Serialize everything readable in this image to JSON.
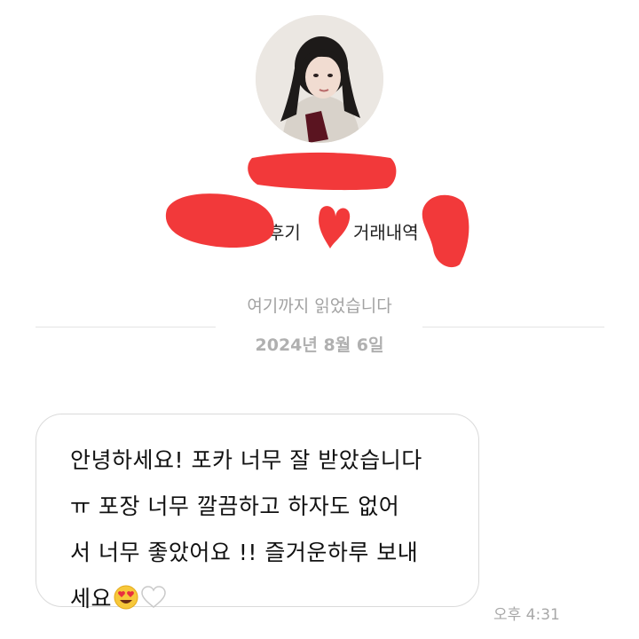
{
  "profile": {
    "link_review": "후기",
    "link_history": "거래내역"
  },
  "thread": {
    "read_marker": "여기까지 읽었습니다",
    "date": "2024년 8월 6일"
  },
  "message": {
    "lines": [
      "안녕하세요! 포카 너무 잘 받았습니다",
      "ㅠ  포장 너무 깔끔하고 하자도 없어",
      "서 너무 좋았어요 !! 즐거운하루 보내",
      "세요"
    ],
    "emoji_icons": [
      "smiling-face-with-heart-eyes-icon",
      "white-heart-icon"
    ],
    "time": "오후 4:31"
  },
  "colors": {
    "redaction": "#f2393a",
    "bubble_border": "#dadada",
    "muted_text": "#a2a2a2"
  }
}
